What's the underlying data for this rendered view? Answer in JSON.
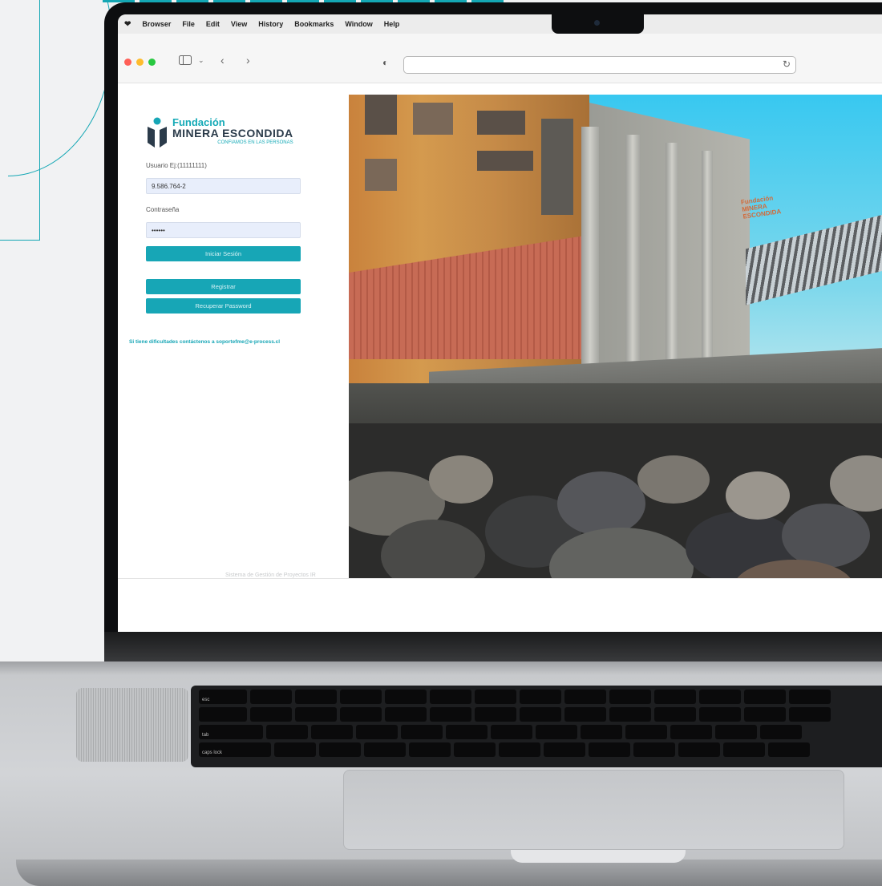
{
  "menubar": {
    "items": [
      "Browser",
      "File",
      "Edit",
      "View",
      "History",
      "Bookmarks",
      "Window",
      "Help"
    ]
  },
  "toolbar": {
    "traffic_lights": [
      "#ff5f57",
      "#febc2e",
      "#28c840"
    ],
    "sidebar_icon": "sidebar-icon",
    "back_icon": "chevron-left-icon",
    "forward_icon": "chevron-right-icon",
    "shield_icon": "shield-icon",
    "reload_icon": "reload-icon",
    "url": ""
  },
  "login": {
    "logo": {
      "line1": "Fundación",
      "line2": "MINERA ESCONDIDA",
      "tagline": "CONFIAMOS EN LAS PERSONAS"
    },
    "user_label": "Usuario Ej:(11111111)",
    "user_value": "9.586.764-2",
    "password_label": "Contraseña",
    "password_value": "••••••",
    "login_button": "Iniciar Sesión",
    "register_button": "Registrar",
    "recover_button": "Recuperar Password",
    "help_text": "Si tiene dificultades contáctenos a soportefme@e-process.cl",
    "footer_text": "Sistema de Gestión de Proyectos IR"
  },
  "photo": {
    "sign_text": "Fundación MINERA ESCONDIDA"
  },
  "colors": {
    "accent": "#17a6b6",
    "brand_dark": "#2b3b4a"
  }
}
